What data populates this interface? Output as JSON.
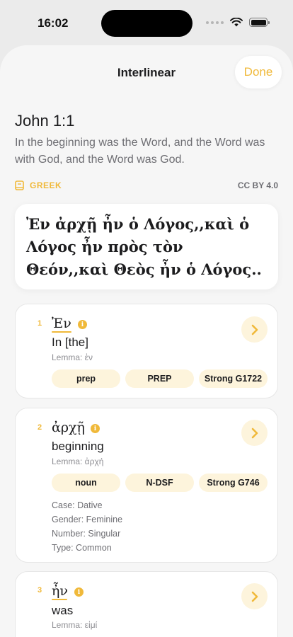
{
  "status": {
    "time": "16:02"
  },
  "nav": {
    "title": "Interlinear",
    "done_label": "Done"
  },
  "verse": {
    "reference": "John 1:1",
    "english": "In the beginning was the Word, and the Word was with God, and the Word was God.",
    "language_label": "GREEK",
    "license": "CC BY 4.0",
    "greek": "Ἐν ἀρχῇ ἦν ὁ Λόγος,,καὶ ὁ Λόγος ἦν πρὸς τὸν Θεόν,,καὶ Θεὸς ἦν ὁ Λόγος.."
  },
  "words": [
    {
      "number": "1",
      "greek": "Ἐν",
      "gloss": "In [the]",
      "lemma": "Lemma: ἐν",
      "tags": [
        "prep",
        "PREP",
        "Strong G1722"
      ]
    },
    {
      "number": "2",
      "greek": "ἀρχῇ",
      "gloss": "beginning",
      "lemma": "Lemma: ἀρχή",
      "tags": [
        "noun",
        "N-DSF",
        "Strong G746"
      ],
      "morphology": [
        "Case: Dative",
        "Gender: Feminine",
        "Number: Singular",
        "Type: Common"
      ]
    },
    {
      "number": "3",
      "greek": "ἦν",
      "gloss": "was",
      "lemma": "Lemma: εἰμί"
    }
  ],
  "colors": {
    "accent": "#f0b93a",
    "accent_light": "#fdf4dc"
  }
}
